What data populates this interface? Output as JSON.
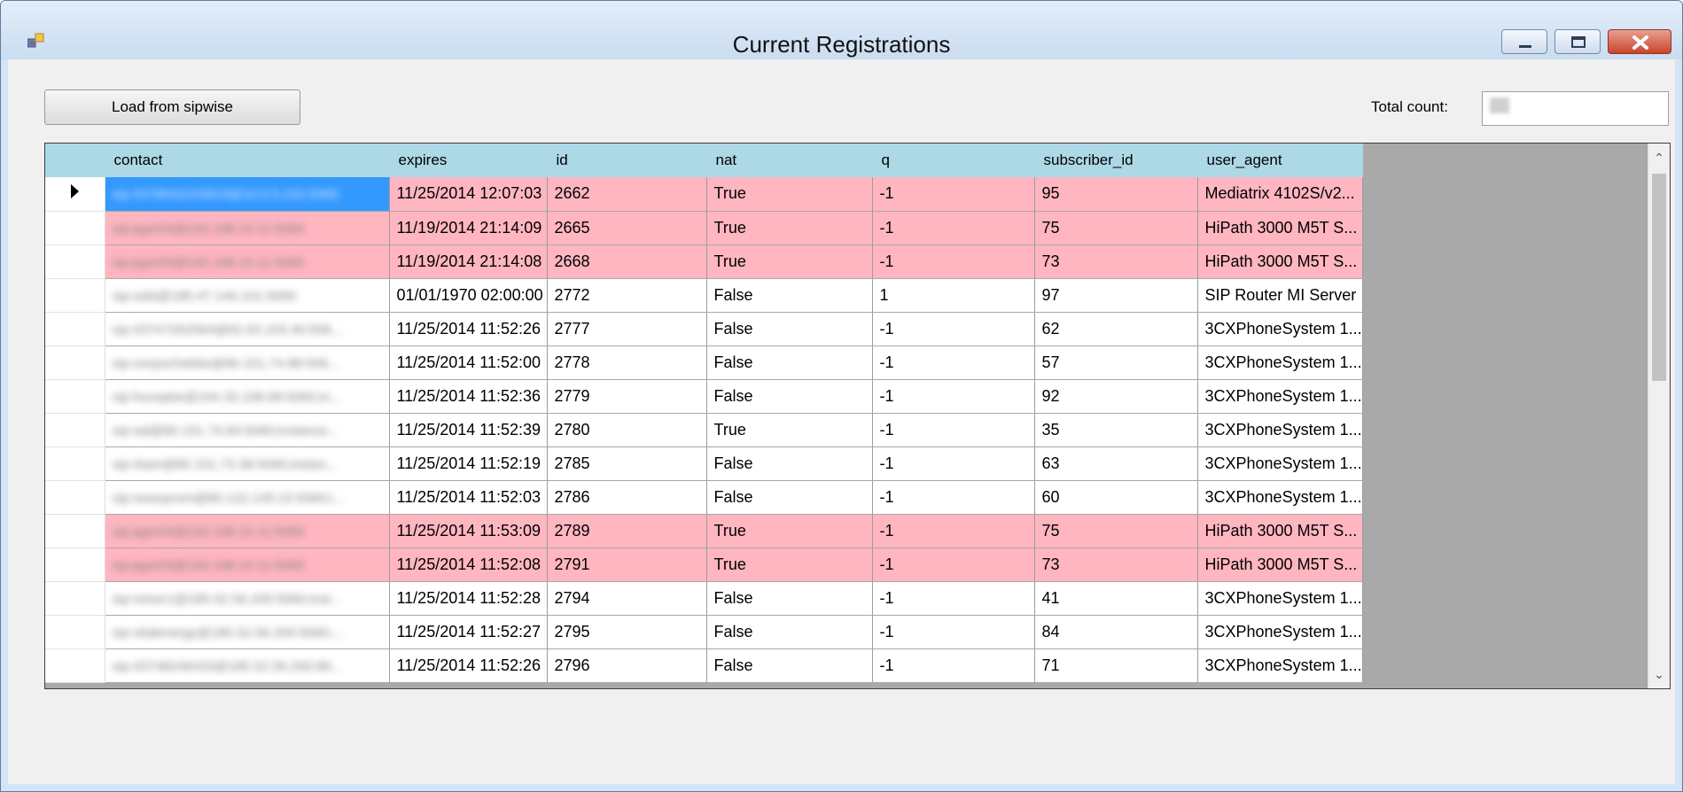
{
  "window": {
    "title": "Current Registrations",
    "icons": [
      "app-icon",
      "minimize-icon",
      "maximize-icon",
      "close-icon"
    ]
  },
  "toolbar": {
    "load_label": "Load from sipwise",
    "total_label": "Total count:",
    "total_value": ""
  },
  "grid": {
    "columns": [
      "contact",
      "expires",
      "id",
      "nat",
      "q",
      "subscriber_id",
      "user_agent"
    ],
    "rows": [
      {
        "contact": "sip:4378532243623@10.0.5.232:5060",
        "expires": "11/25/2014 12:07:03",
        "id": "2662",
        "nat": "True",
        "q": "-1",
        "subscriber_id": "95",
        "user_agent": "Mediatrix 4102S/v2...",
        "highlight": true,
        "selected": true
      },
      {
        "contact": "sip:pgsr04@192.168.10.11:5060",
        "expires": "11/19/2014 21:14:09",
        "id": "2665",
        "nat": "True",
        "q": "-1",
        "subscriber_id": "75",
        "user_agent": "HiPath 3000 M5T S...",
        "highlight": true
      },
      {
        "contact": "sip:pgsr03@192.168.10.11:5060",
        "expires": "11/19/2014 21:14:08",
        "id": "2668",
        "nat": "True",
        "q": "-1",
        "subscriber_id": "73",
        "user_agent": "HiPath 3000 M5T S...",
        "highlight": true
      },
      {
        "contact": "sip:sebi@185.47.140.101:5060",
        "expires": "01/01/1970 02:00:00",
        "id": "2772",
        "nat": "False",
        "q": "1",
        "subscriber_id": "97",
        "user_agent": "SIP Router MI Server",
        "highlight": false
      },
      {
        "contact": "sip:43747262564@62.93.103.40:506...",
        "expires": "11/25/2014 11:52:26",
        "id": "2777",
        "nat": "False",
        "q": "-1",
        "subscriber_id": "62",
        "user_agent": "3CXPhoneSystem 1...",
        "highlight": false
      },
      {
        "contact": "sip:cevpschebbe@80.151.74.88:506...",
        "expires": "11/25/2014 11:52:00",
        "id": "2778",
        "nat": "False",
        "q": "-1",
        "subscriber_id": "57",
        "user_agent": "3CXPhoneSystem 1...",
        "highlight": false
      },
      {
        "contact": "sip:hoospbe@194.33.108.68:5060;in...",
        "expires": "11/25/2014 11:52:36",
        "id": "2779",
        "nat": "False",
        "q": "-1",
        "subscriber_id": "92",
        "user_agent": "3CXPhoneSystem 1...",
        "highlight": false
      },
      {
        "contact": "sip:sal@80.151.74.84:5060;instance...",
        "expires": "11/25/2014 11:52:39",
        "id": "2780",
        "nat": "True",
        "q": "-1",
        "subscriber_id": "35",
        "user_agent": "3CXPhoneSystem 1...",
        "highlight": false
      },
      {
        "contact": "sip:rkam@80.151.73.38:5060;instan...",
        "expires": "11/25/2014 11:52:19",
        "id": "2785",
        "nat": "False",
        "q": "-1",
        "subscriber_id": "63",
        "user_agent": "3CXPhoneSystem 1...",
        "highlight": false
      },
      {
        "contact": "sip:newsprom@80.122.149.22:5060;i...",
        "expires": "11/25/2014 11:52:03",
        "id": "2786",
        "nat": "False",
        "q": "-1",
        "subscriber_id": "60",
        "user_agent": "3CXPhoneSystem 1...",
        "highlight": false
      },
      {
        "contact": "sip:pgsr04@192.168.10.11:5060",
        "expires": "11/25/2014 11:53:09",
        "id": "2789",
        "nat": "True",
        "q": "-1",
        "subscriber_id": "75",
        "user_agent": "HiPath 3000 M5T S...",
        "highlight": true
      },
      {
        "contact": "sip:pgsr03@192.168.10.11:5060",
        "expires": "11/25/2014 11:52:08",
        "id": "2791",
        "nat": "True",
        "q": "-1",
        "subscriber_id": "73",
        "user_agent": "HiPath 3000 M5T S...",
        "highlight": true
      },
      {
        "contact": "sip:reiner1@185.52.56.200:5060;inst...",
        "expires": "11/25/2014 11:52:28",
        "id": "2794",
        "nat": "False",
        "q": "-1",
        "subscriber_id": "41",
        "user_agent": "3CXPhoneSystem 1...",
        "highlight": false
      },
      {
        "contact": "sip:vitalenergy@185.52.56.200:5060;...",
        "expires": "11/25/2014 11:52:27",
        "id": "2795",
        "nat": "False",
        "q": "-1",
        "subscriber_id": "84",
        "user_agent": "3CXPhoneSystem 1...",
        "highlight": false
      },
      {
        "contact": "sip:43748246433@185.52.56.200:80...",
        "expires": "11/25/2014 11:52:26",
        "id": "2796",
        "nat": "False",
        "q": "-1",
        "subscriber_id": "71",
        "user_agent": "3CXPhoneSystem 1...",
        "highlight": false
      }
    ]
  },
  "colors": {
    "header": "#add8e6",
    "highlight_row": "#ffb6c1",
    "selection": "#3399ff"
  }
}
